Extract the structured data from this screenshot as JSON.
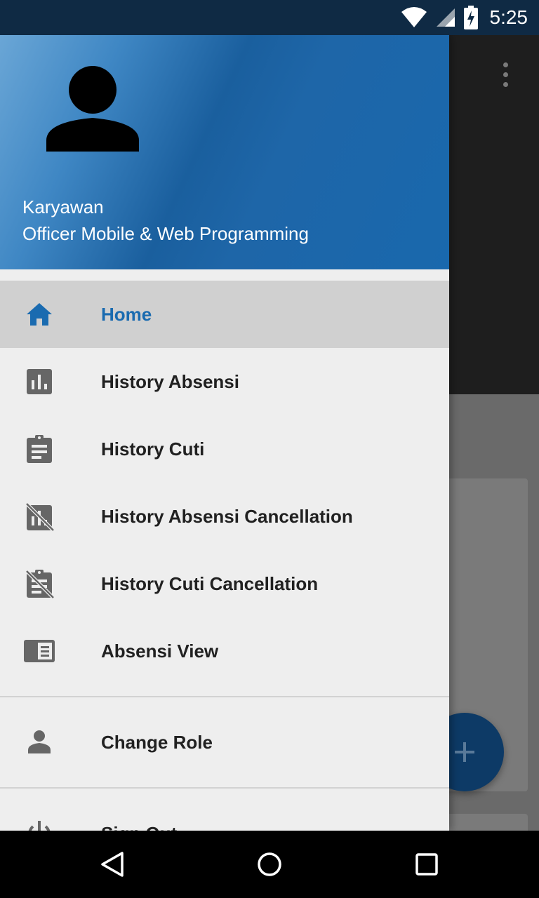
{
  "status_bar": {
    "time": "5:25",
    "icons": [
      "wifi-icon",
      "signal-icon",
      "battery-charging-icon"
    ]
  },
  "drawer": {
    "header": {
      "avatar_icon": "person-icon",
      "name": "Karyawan",
      "role": "Officer Mobile & Web Programming"
    },
    "items": [
      {
        "label": "Home",
        "icon": "home-icon",
        "active": true
      },
      {
        "label": "History Absensi",
        "icon": "bar-chart-icon",
        "active": false
      },
      {
        "label": "History Cuti",
        "icon": "clipboard-icon",
        "active": false
      },
      {
        "label": "History Absensi Cancellation",
        "icon": "bar-chart-off-icon",
        "active": false
      },
      {
        "label": "History Cuti Cancellation",
        "icon": "clipboard-off-icon",
        "active": false
      },
      {
        "label": "Absensi View",
        "icon": "view-list-icon",
        "active": false
      }
    ],
    "secondary_items": [
      {
        "label": "Change Role",
        "icon": "person-icon"
      },
      {
        "label": "Sign Out",
        "icon": "power-icon"
      }
    ]
  },
  "background_app": {
    "menu_icon": "more-vert-icon",
    "fab_icon": "add-icon"
  },
  "nav_bar": {
    "icons": [
      "back-icon",
      "home-circle-icon",
      "recents-icon"
    ]
  },
  "colors": {
    "accent": "#1a6bb0",
    "drawer_bg": "#eeeeee",
    "active_item_bg": "#d0d0d0",
    "icon_gray": "#666666"
  }
}
